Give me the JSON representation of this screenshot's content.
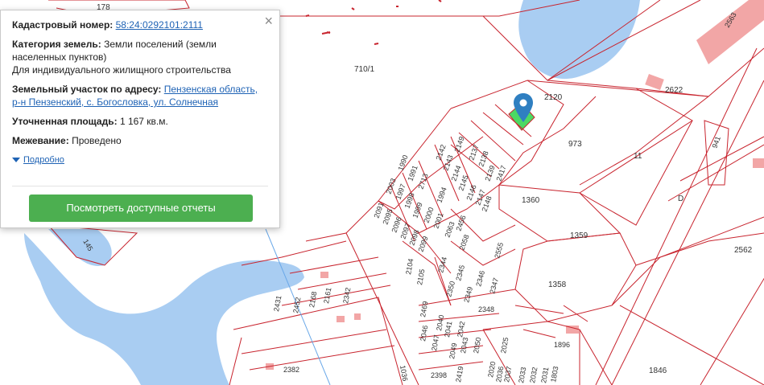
{
  "popup": {
    "cadastral_label": "Кадастровый номер:",
    "cadastral_value": "58:24:0292101:2111",
    "category_label": "Категория земель:",
    "category_value": "Земли поселений (земли населенных пунктов)",
    "use_value": "Для индивидуального жилищного строительства",
    "address_label": "Земельный участок по адресу:",
    "address_value": "Пензенская область, р-н Пензенский, с. Богословка, ул. Солнечная",
    "area_label": "Уточненная площадь:",
    "area_value": "1 167 кв.м.",
    "survey_label": "Межевание:",
    "survey_value": "Проведено",
    "more_label": "Подробно",
    "button_label": "Посмотреть доступные отчеты",
    "close_glyph": "×"
  },
  "map": {
    "colors": {
      "boundary": "#c8242e",
      "water": "#a9cdf2",
      "building": "#f2a6a6",
      "selected": "#4cd964",
      "pin": "#2f7fc1"
    },
    "labels": {
      "p178": "178",
      "p710": "710/1",
      "p2120": "2120",
      "p2622": "2622",
      "p2563": "2563",
      "p973": "973",
      "p11": "11",
      "p941": "941",
      "p1360": "1360",
      "p1359": "1359",
      "p1358": "1358",
      "p2562": "2562",
      "p1846": "1846",
      "p1896": "1896",
      "p1803": "1803",
      "pD": "D",
      "p145": "145",
      "p2382": "2382",
      "p1036": "1036",
      "p2431": "2431",
      "p2452": "2452",
      "p2161": "2161",
      "p2168": "2168",
      "p2342": "2342",
      "p2003": "2003",
      "p1990": "1990",
      "p1997": "1997",
      "p1991": "1991",
      "p1998": "1998",
      "p2713": "2713",
      "p1999": "1999",
      "p1994": "1994",
      "p2000": "2000",
      "p2001": "2001",
      "p2091": "2091",
      "p2095": "2095",
      "p2096": "2096",
      "p2097": "2097",
      "p2098": "2098",
      "p2099": "2099",
      "p2104": "2104",
      "p2105": "2105",
      "p2063": "2063",
      "p2456": "2456",
      "p2058": "2058",
      "p2344": "2344",
      "p2555": "2555",
      "p2345": "2345",
      "p2350": "2350",
      "p2349": "2349",
      "p2346": "2346",
      "p2347": "2347",
      "p2348": "2348",
      "p2142": "2142",
      "p2143": "2143",
      "p2144": "2144",
      "p2145": "2145",
      "p2146": "2146",
      "p2147": "2147",
      "p2148": "2148",
      "p2149": "2149",
      "p2137": "2137",
      "p2138": "2138",
      "p2139": "2139",
      "p2417": "2417",
      "p2469": "2469",
      "p2046": "2046",
      "p2047": "2047",
      "p2040": "2040",
      "p2041": "2041",
      "p2042": "2042",
      "p2043": "2043",
      "p2049": "2049",
      "p2050": "2050",
      "p2398": "2398",
      "p2419": "2419",
      "p2020": "2020",
      "p2025": "2025",
      "p2036": "2036",
      "p2037": "2037",
      "p2033": "2033",
      "p2032": "2032",
      "p2031": "2031"
    }
  }
}
